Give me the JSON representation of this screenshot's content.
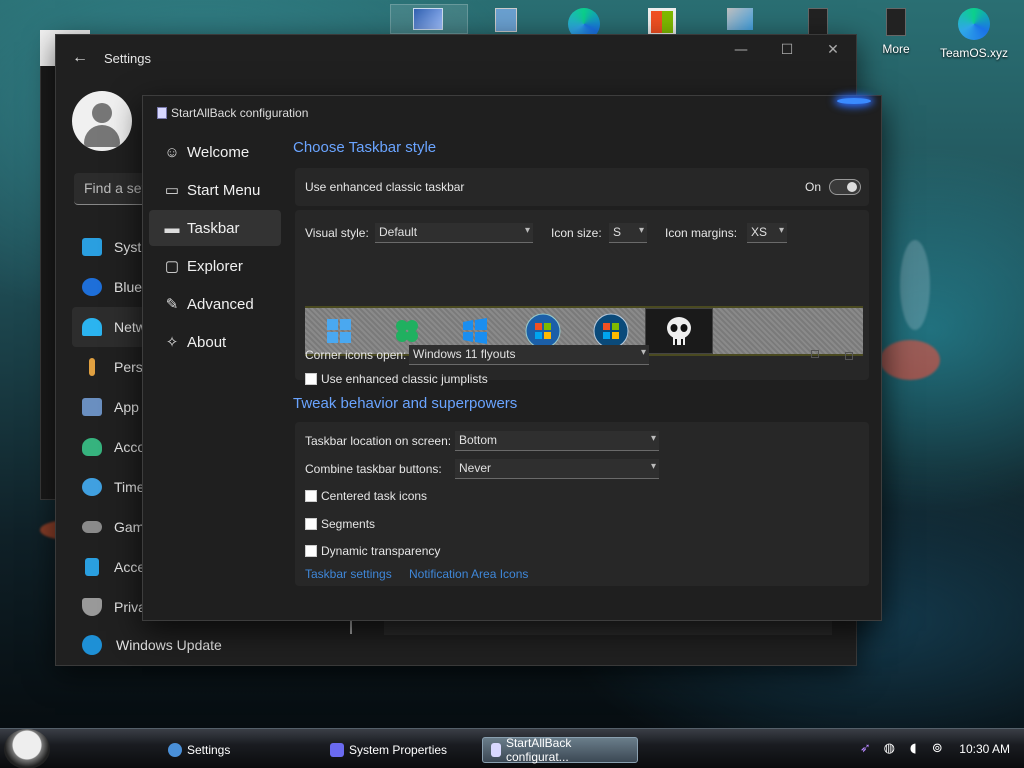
{
  "desktop": {
    "icons": [
      {
        "label": "",
        "icon": "window-icon"
      },
      {
        "label": "",
        "icon": "pc-icon"
      },
      {
        "label": "",
        "icon": "edge-icon"
      },
      {
        "label": "",
        "icon": "store-icon"
      },
      {
        "label": "",
        "icon": "network-icon"
      },
      {
        "label": "",
        "icon": "shortcut-icon"
      },
      {
        "label": "More",
        "icon": "folder-icon"
      },
      {
        "label": "TeamOS.xyz",
        "icon": "edge-icon"
      }
    ]
  },
  "settings": {
    "title": "Settings",
    "search_placeholder": "Find a set",
    "nav": [
      {
        "label": "Syst",
        "color": "#2a9fe0"
      },
      {
        "label": "Blue",
        "color": "#1e6fd9"
      },
      {
        "label": "Netw",
        "color": "#2bb4f0"
      },
      {
        "label": "Pers",
        "color": "#e0a040"
      },
      {
        "label": "App",
        "color": "#6a8fc0"
      },
      {
        "label": "Acco",
        "color": "#36b37e"
      },
      {
        "label": "Time",
        "color": "#40a0e0"
      },
      {
        "label": "Gam",
        "color": "#8a8a8a"
      },
      {
        "label": "Acce",
        "color": "#2a9fe0"
      },
      {
        "label": "Priva",
        "color": "#999999"
      }
    ],
    "windows_update": "Windows Update"
  },
  "sab": {
    "title": "StartAllBack configuration",
    "nav": [
      {
        "label": "Welcome",
        "icon": "☺"
      },
      {
        "label": "Start Menu",
        "icon": "▭"
      },
      {
        "label": "Taskbar",
        "icon": "▬"
      },
      {
        "label": "Explorer",
        "icon": "▢"
      },
      {
        "label": "Advanced",
        "icon": "✎"
      },
      {
        "label": "About",
        "icon": "✧"
      }
    ],
    "section1": "Choose Taskbar style",
    "enhanced_label": "Use enhanced classic taskbar",
    "enhanced_state": "On",
    "visual_style_label": "Visual style:",
    "visual_style_value": "Default",
    "icon_size_label": "Icon size:",
    "icon_size_value": "S",
    "icon_margins_label": "Icon margins:",
    "icon_margins_value": "XS",
    "corner_icons_label": "Corner icons open:",
    "corner_icons_value": "Windows 11 flyouts",
    "jumplists_label": "Use enhanced classic jumplists",
    "section2": "Tweak behavior and superpowers",
    "location_label": "Taskbar location on screen:",
    "location_value": "Bottom",
    "combine_label": "Combine taskbar buttons:",
    "combine_value": "Never",
    "centered_label": "Centered task icons",
    "segments_label": "Segments",
    "transparency_label": "Dynamic transparency",
    "link1": "Taskbar settings",
    "link2": "Notification Area Icons"
  },
  "taskbar": {
    "buttons": [
      {
        "label": "Settings",
        "color": "#4a90d9"
      },
      {
        "label": "System Properties",
        "color": "#6a6af0"
      },
      {
        "label": "StartAllBack configurat...",
        "color": "#d8d8ff"
      }
    ],
    "clock": "10:30 AM"
  }
}
